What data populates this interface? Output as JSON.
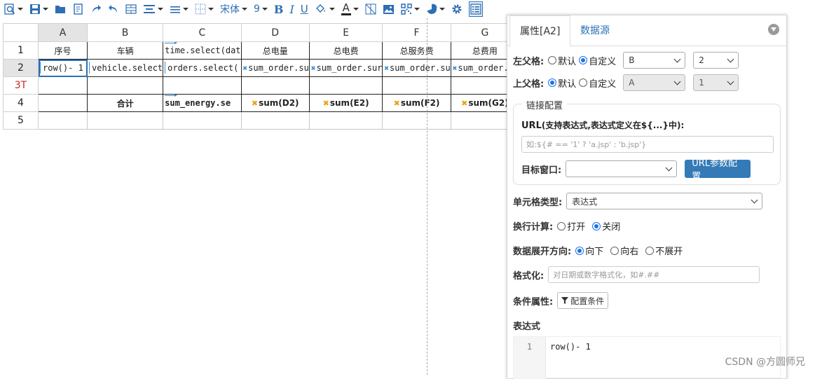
{
  "toolbar": {
    "icons": [
      "search-icon",
      "save-icon",
      "open-folder-icon",
      "export-icon",
      "redo-icon",
      "undo-icon",
      "merge-icon",
      "align-icon",
      "line-spacing-icon",
      "border-icon",
      "font-name",
      "font-size",
      "bold-icon",
      "italic-icon",
      "underline-icon",
      "fill-color-icon",
      "font-color-icon",
      "no-border-icon",
      "image-icon",
      "qrcode-icon",
      "chart-icon",
      "settings-icon",
      "property-panel-icon"
    ],
    "font_name": "宋体",
    "font_size": "9",
    "bold": "B",
    "italic": "I",
    "underline": "U",
    "font_color_letter": "A"
  },
  "sheet": {
    "columns": [
      "A",
      "B",
      "C",
      "D",
      "E",
      "F",
      "G"
    ],
    "rows": [
      "1",
      "2",
      "3T",
      "4",
      "5"
    ],
    "r1": [
      "",
      "序号",
      "车辆",
      "time.select(dat",
      "总电量",
      "总电费",
      "总服务费",
      "总费用"
    ],
    "r2": [
      "row()- 1",
      "vehicle.select",
      "orders.select(",
      "sum_order.su",
      "sum_order.sur",
      "sum_order.su",
      "sum_order.su"
    ],
    "r4": [
      "",
      "合计",
      "sum_energy.se",
      "sum(D2)",
      "sum(E2)",
      "sum(F2)",
      "sum(G2)"
    ]
  },
  "panel": {
    "tab_active": "属性[A2]",
    "tab_other": "数据源",
    "left_parent": {
      "label": "左父格:",
      "opt_default": "默认",
      "opt_custom": "自定义",
      "cell": "B",
      "index": "2",
      "selected": "custom"
    },
    "top_parent": {
      "label": "上父格:",
      "opt_default": "默认",
      "opt_custom": "自定义",
      "cell": "A",
      "index": "1",
      "selected": "default"
    },
    "link": {
      "legend": "链接配置",
      "url_label": "URL",
      "url_hint": "(支持表达式,表达式定义在${...}中):",
      "url_placeholder": "如:${# == '1' ? 'a.jsp' : 'b.jsp'}",
      "target_label": "目标窗口:",
      "target_value": "",
      "param_button": "URL参数配置"
    },
    "cell_type": {
      "label": "单元格类型:",
      "value": "表达式"
    },
    "wrap_calc": {
      "label": "换行计算:",
      "on": "打开",
      "off": "关闭",
      "selected": "off"
    },
    "expand": {
      "label": "数据展开方向:",
      "down": "向下",
      "right": "向右",
      "none": "不展开",
      "selected": "down"
    },
    "format": {
      "label": "格式化:",
      "placeholder": "对日期或数字格式化，如#.##"
    },
    "condition": {
      "label": "条件属性:",
      "button": "配置条件"
    },
    "expression": {
      "label": "表达式",
      "line_no": "1",
      "code": "row()- 1"
    }
  },
  "watermark": "CSDN @方圆师兄",
  "colors": {
    "accent": "#2c6fb5",
    "primary_button": "#337ab7",
    "radio_on": "#1a73e8",
    "row_header_red": "#c62828",
    "sum_icon": "#e8a40d"
  }
}
